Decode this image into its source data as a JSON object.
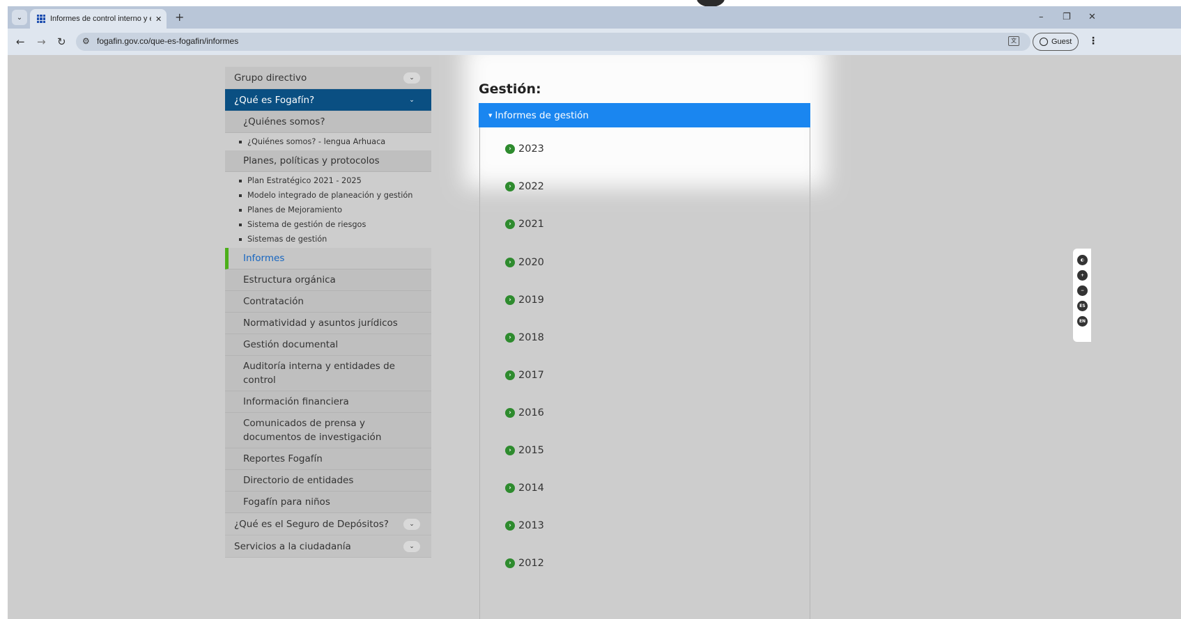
{
  "browser": {
    "tab_title": "Informes de control interno y e",
    "tab_close": "✕",
    "new_tab": "+",
    "url": "fogafin.gov.co/que-es-fogafin/informes",
    "profile_label": "Guest",
    "window_controls": [
      "–",
      "❐",
      "✕"
    ]
  },
  "sidebar": {
    "top_items": [
      {
        "label": "Grupo directivo"
      },
      {
        "label": "¿Qué es Fogafín?",
        "active": true
      }
    ],
    "section_quienes": "¿Quiénes somos?",
    "quienes_items": [
      "¿Quiénes somos? - lengua Arhuaca"
    ],
    "section_planes": "Planes, políticas y protocolos",
    "planes_items": [
      "Plan Estratégico 2021 - 2025",
      "Modelo integrado de planeación y gestión",
      "Planes de Mejoramiento",
      "Sistema de gestión de riesgos",
      "Sistemas de gestión"
    ],
    "current_item": "Informes",
    "sub_items": [
      "Estructura orgánica",
      "Contratación",
      "Normatividad y asuntos jurídicos",
      "Gestión documental",
      "Auditoría interna y entidades de control",
      "Información financiera",
      "Comunicados de prensa y documentos de investigación",
      "Reportes Fogafín",
      "Directorio de entidades",
      "Fogafín para niños"
    ],
    "bottom_items": [
      {
        "label": "¿Qué es el Seguro de Depósitos?"
      },
      {
        "label": "Servicios a la ciudadanía"
      }
    ]
  },
  "content": {
    "heading": "Gestión:",
    "accordion_title": "Informes de gestión",
    "years": [
      "2023",
      "2022",
      "2021",
      "2020",
      "2019",
      "2018",
      "2017",
      "2016",
      "2015",
      "2014",
      "2013",
      "2012"
    ]
  },
  "accessibility_widget": {
    "buttons": [
      {
        "icon": "contrast-icon",
        "label": "◐"
      },
      {
        "icon": "zoom-in-icon",
        "label": "+"
      },
      {
        "icon": "zoom-out-icon",
        "label": "−"
      },
      {
        "icon": "language-es-icon",
        "label": "ES"
      },
      {
        "icon": "language-en-icon",
        "label": "EN"
      }
    ]
  },
  "colors": {
    "sidebar_active": "#0a4f82",
    "accordion_header": "#1a86f0",
    "current_marker": "#4caf1a",
    "year_icon": "#2e8b2e"
  }
}
